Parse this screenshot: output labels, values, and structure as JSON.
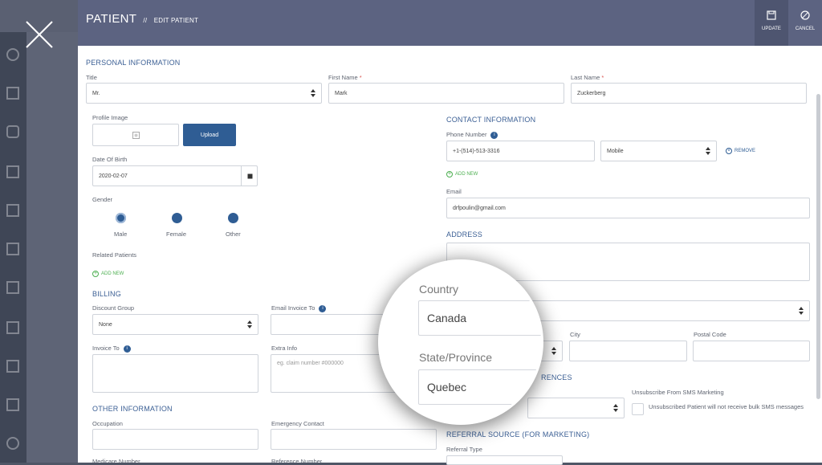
{
  "header": {
    "title": "PATIENT",
    "separator": "//",
    "subtitle": "EDIT PATIENT",
    "update_label": "UPDATE",
    "cancel_label": "CANCEL"
  },
  "personal": {
    "section": "PERSONAL INFORMATION",
    "title_label": "Title",
    "title_value": "Mr.",
    "first_name_label": "First Name",
    "first_name_value": "Mark",
    "last_name_label": "Last Name",
    "last_name_value": "Zuckerberg",
    "required_mark": "*",
    "profile_image_label": "Profile Image",
    "upload_label": "Upload",
    "dob_label": "Date Of Birth",
    "dob_value": "2020-02-07",
    "gender_label": "Gender",
    "gender_options": [
      "Male",
      "Female",
      "Other"
    ],
    "related_label": "Related Patients",
    "add_new": "ADD NEW"
  },
  "billing": {
    "section": "BILLING",
    "discount_label": "Discount Group",
    "discount_value": "None",
    "email_invoice_label": "Email Invoice To",
    "invoice_to_label": "Invoice To",
    "extra_info_label": "Extra Info",
    "extra_info_placeholder": "eg. claim number #000000"
  },
  "other": {
    "section": "OTHER INFORMATION",
    "occupation_label": "Occupation",
    "emergency_label": "Emergency Contact",
    "medicare_label": "Medicare Number",
    "reference_label": "Reference Number"
  },
  "contact": {
    "section": "CONTACT INFORMATION",
    "phone_label": "Phone Number",
    "phone_value": "+1-(514)-513-3316",
    "phone_type": "Mobile",
    "remove_label": "REMOVE",
    "add_new": "ADD NEW",
    "email_label": "Email",
    "email_value": "drfpoulin@gmail.com"
  },
  "address": {
    "section": "ADDRESS",
    "city_label": "City",
    "postal_label": "Postal Code"
  },
  "preferences": {
    "section_fragment": "RENCES",
    "sms_label": "Unsubscribe From SMS Marketing",
    "sms_text": "Unsubscribed Patient will not receive bulk SMS messages"
  },
  "referral": {
    "section": "REFERRAL SOURCE (FOR MARKETING)",
    "type_label": "Referral Type"
  },
  "magnifier": {
    "country_label": "Country",
    "country_value": "Canada",
    "state_label": "State/Province",
    "state_value": "Quebec"
  },
  "icons": {
    "close": "close-icon",
    "update": "save-icon",
    "cancel": "cancel-icon",
    "image": "image-placeholder-icon",
    "calendar": "calendar-icon",
    "info": "info-icon"
  },
  "colors": {
    "accent": "#2f5d94",
    "header": "#5c6381",
    "add": "#4caf50",
    "required": "#d9534f"
  }
}
